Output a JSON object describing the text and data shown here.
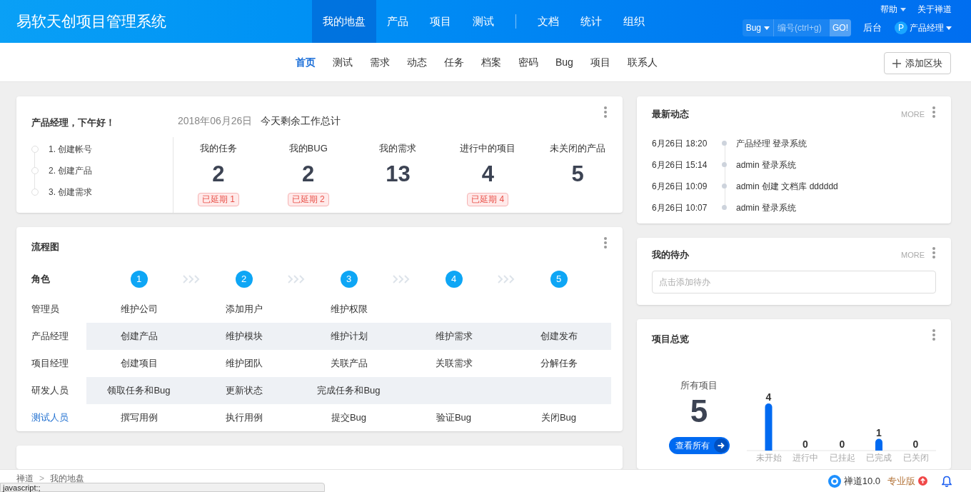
{
  "header": {
    "logo": "易软天创项目管理系统",
    "nav_groups": [
      [
        {
          "label": "我的地盘",
          "selected": true
        },
        {
          "label": "产品",
          "selected": false
        },
        {
          "label": "项目",
          "selected": false
        },
        {
          "label": "测试",
          "selected": false
        }
      ],
      [
        {
          "label": "文档",
          "selected": false
        },
        {
          "label": "统计",
          "selected": false
        },
        {
          "label": "组织",
          "selected": false
        }
      ]
    ],
    "help": "帮助",
    "about": "关于禅道",
    "search": {
      "type": "Bug",
      "placeholder": "编号(ctrl+g)",
      "button": "GO!"
    },
    "admin": "后台",
    "user": {
      "initial": "P",
      "name": "产品经理"
    }
  },
  "subnav": {
    "items": [
      {
        "label": "首页",
        "selected": true
      },
      {
        "label": "测试",
        "selected": false
      },
      {
        "label": "需求",
        "selected": false
      },
      {
        "label": "动态",
        "selected": false
      },
      {
        "label": "任务",
        "selected": false
      },
      {
        "label": "档案",
        "selected": false
      },
      {
        "label": "密码",
        "selected": false
      },
      {
        "label": "Bug",
        "selected": false
      },
      {
        "label": "项目",
        "selected": false
      },
      {
        "label": "联系人",
        "selected": false
      }
    ],
    "add_block": "添加区块"
  },
  "welcome": {
    "greeting": "产品经理，下午好！",
    "steps": [
      {
        "label": "1. 创建帐号",
        "done": false
      },
      {
        "label": "2. 创建产品",
        "done": false
      },
      {
        "label": "3. 创建需求",
        "done": false
      }
    ],
    "date": "2018年06月26日",
    "summary_title": "今天剩余工作总计",
    "stats": [
      {
        "label": "我的任务",
        "value": "2",
        "overdue": "已延期 1"
      },
      {
        "label": "我的BUG",
        "value": "2",
        "overdue": "已延期 2"
      },
      {
        "label": "我的需求",
        "value": "13"
      },
      {
        "label": "进行中的项目",
        "value": "4",
        "overdue": "已延期 4"
      },
      {
        "label": "未关闭的产品",
        "value": "5"
      }
    ]
  },
  "flow": {
    "title": "流程图",
    "role_header": "角色",
    "steps": [
      "1",
      "2",
      "3",
      "4",
      "5"
    ],
    "rows": [
      {
        "role": "管理员",
        "highlighted": false,
        "shaded": false,
        "cells": [
          "维护公司",
          "添加用户",
          "维护权限",
          null,
          null
        ]
      },
      {
        "role": "产品经理",
        "highlighted": false,
        "shaded": true,
        "cells": [
          "创建产品",
          "维护模块",
          "维护计划",
          "维护需求",
          "创建发布"
        ]
      },
      {
        "role": "项目经理",
        "highlighted": false,
        "shaded": false,
        "cells": [
          "创建项目",
          "维护团队",
          "关联产品",
          "关联需求",
          "分解任务"
        ]
      },
      {
        "role": "研发人员",
        "highlighted": false,
        "shaded": true,
        "cells": [
          "领取任务和Bug",
          "更新状态",
          "完成任务和Bug",
          null,
          null
        ]
      },
      {
        "role": "测试人员",
        "highlighted": true,
        "shaded": false,
        "cells": [
          "撰写用例",
          "执行用例",
          "提交Bug",
          "验证Bug",
          "关闭Bug"
        ]
      }
    ]
  },
  "activity": {
    "title": "最新动态",
    "more": "MORE",
    "items": [
      {
        "time": "6月26日 18:20",
        "text": "产品经理 登录系统"
      },
      {
        "time": "6月26日 15:14",
        "text": "admin 登录系统"
      },
      {
        "time": "6月26日 10:09",
        "text": "admin 创建 文档库 dddddd"
      },
      {
        "time": "6月26日 10:07",
        "text": "admin 登录系统"
      }
    ]
  },
  "todo": {
    "title": "我的待办",
    "more": "MORE",
    "placeholder": "点击添加待办"
  },
  "projects": {
    "title": "项目总览",
    "all_label": "所有项目",
    "all_value": "5",
    "view_all": "查看所有",
    "chart_data": {
      "type": "bar",
      "categories": [
        "未开始",
        "进行中",
        "已挂起",
        "已完成",
        "已关闭"
      ],
      "series": [
        {
          "color": "#006af1",
          "values": [
            4,
            0,
            0,
            1,
            0
          ]
        }
      ],
      "data_labels": true
    }
  },
  "footer": {
    "breadcrumb": [
      "禅道",
      "我的地盘"
    ],
    "separator": ">",
    "version": "禅道10.0",
    "edition": "专业版"
  },
  "browser_status": "javascript:;"
}
